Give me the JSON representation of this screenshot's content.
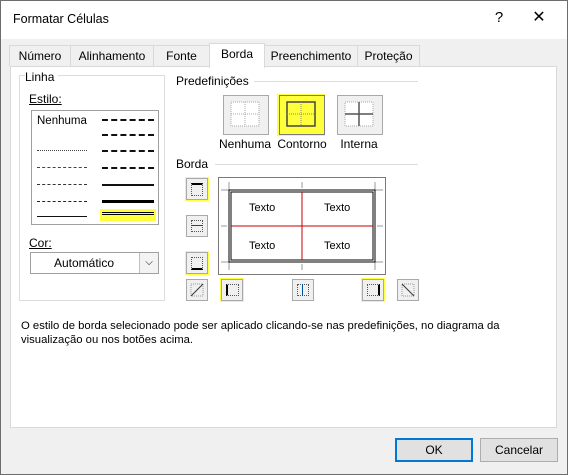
{
  "window": {
    "title": "Formatar Células",
    "help": "?",
    "close": "✕"
  },
  "tabs": [
    {
      "label": "Número"
    },
    {
      "label": "Alinhamento"
    },
    {
      "label": "Fonte"
    },
    {
      "label": "Borda"
    },
    {
      "label": "Preenchimento"
    },
    {
      "label": "Proteção"
    }
  ],
  "active_tab": "Borda",
  "line": {
    "group_label": "Linha",
    "style_label": "Estilo:",
    "none_label": "Nenhuma",
    "color_label": "Cor:",
    "color_value": "Automático"
  },
  "presets": {
    "group_label": "Predefinições",
    "items": [
      {
        "label": "Nenhuma"
      },
      {
        "label": "Contorno"
      },
      {
        "label": "Interna"
      }
    ]
  },
  "border": {
    "group_label": "Borda",
    "preview_cells": [
      "Texto",
      "Texto",
      "Texto",
      "Texto"
    ]
  },
  "info_text": "O estilo de borda selecionado pode ser aplicado clicando-se nas predefinições, no diagrama da visualização ou nos botões acima.",
  "buttons": {
    "ok": "OK",
    "cancel": "Cancelar"
  },
  "colors": {
    "highlight": "#ffff3b",
    "inner_line": "#c00000",
    "accent": "#0078d7"
  }
}
